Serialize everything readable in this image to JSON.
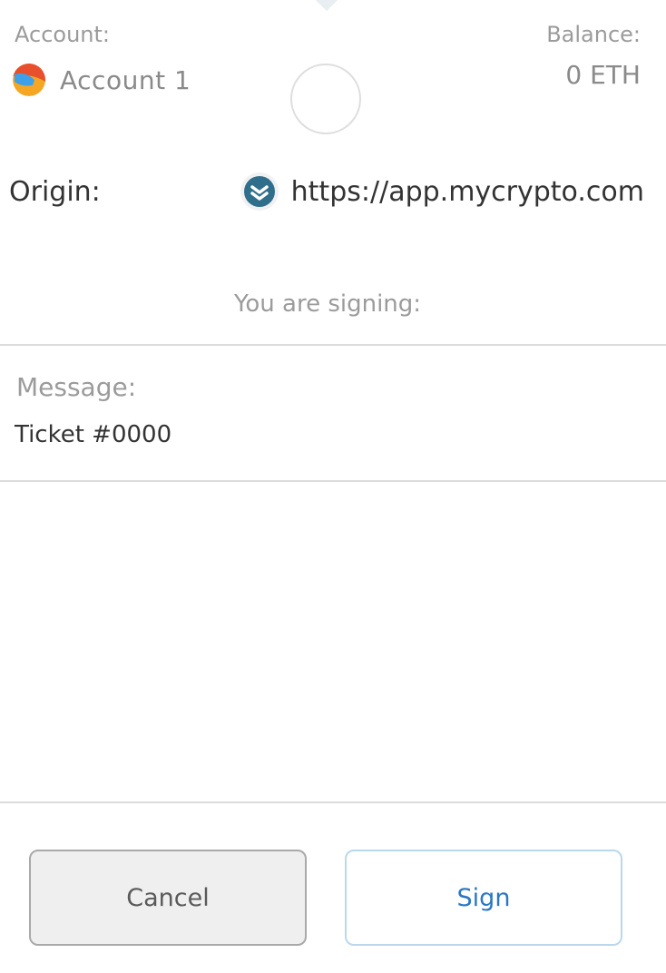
{
  "account": {
    "label": "Account:",
    "name": "Account 1"
  },
  "balance": {
    "label": "Balance:",
    "value": "0 ETH"
  },
  "origin": {
    "label": "Origin:",
    "url": "https://app.mycrypto.com"
  },
  "signing": {
    "heading": "You are signing:"
  },
  "message": {
    "label": "Message:",
    "value": "Ticket #0000"
  },
  "actions": {
    "cancel_label": "Cancel",
    "sign_label": "Sign"
  },
  "colors": {
    "sign_accent": "#2a77c4",
    "site_icon": "#2f6f8c"
  },
  "icons": {
    "account_avatar": "account-avatar-icon",
    "site": "mycrypto-site-icon"
  }
}
